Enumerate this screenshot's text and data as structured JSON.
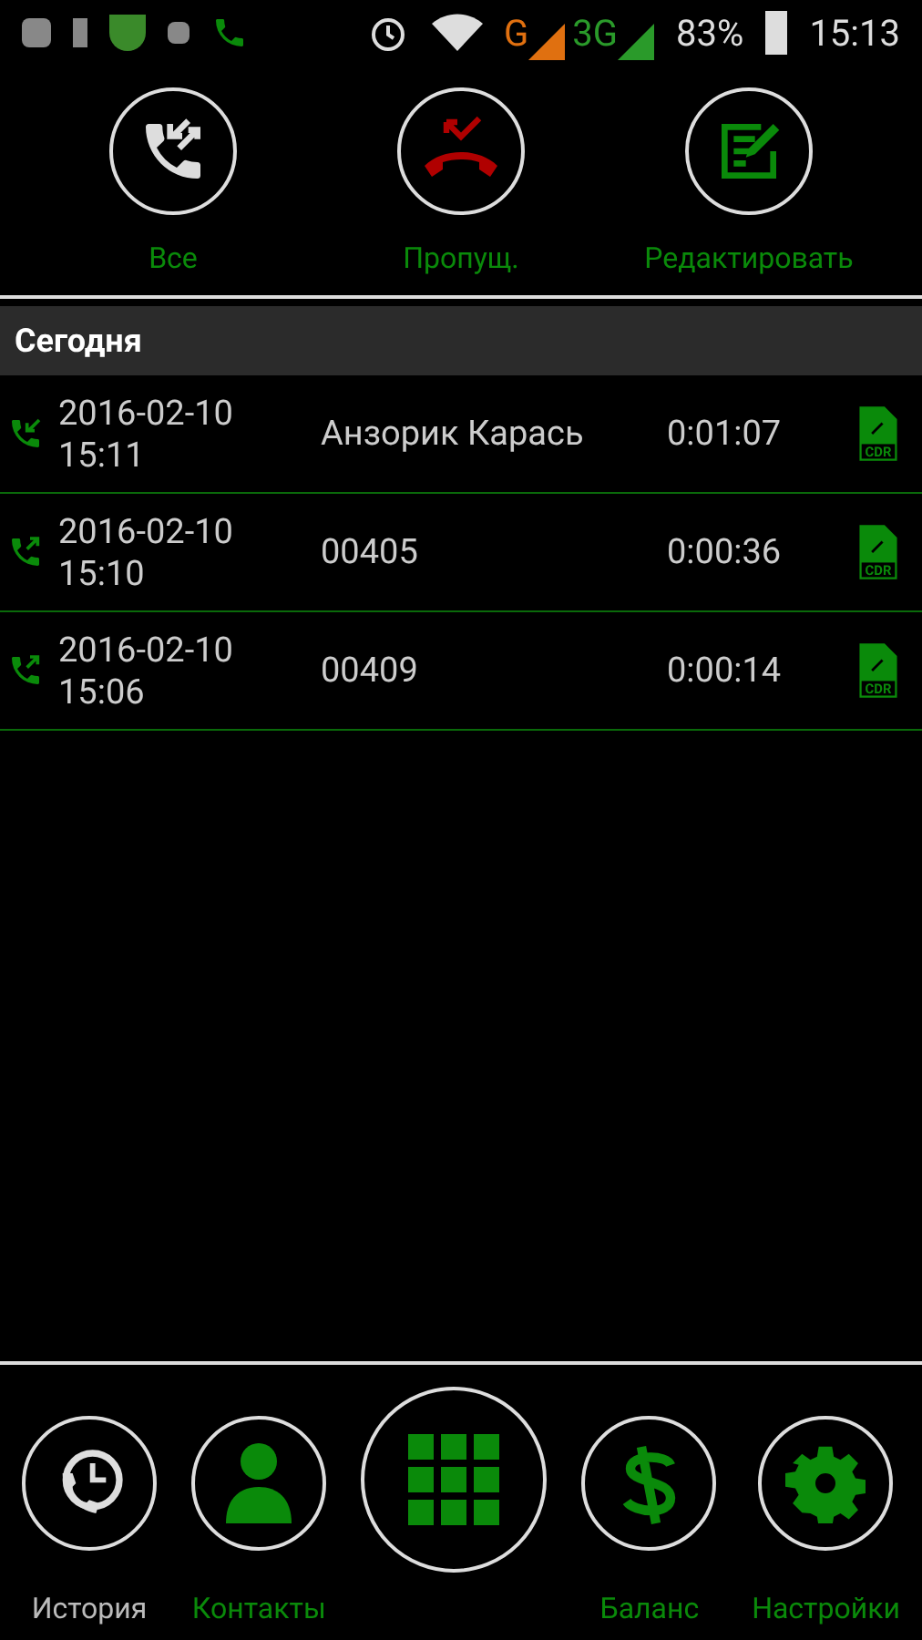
{
  "status_bar": {
    "network_2g": "G",
    "network_3g": "3G",
    "battery": "83%",
    "time": "15:13"
  },
  "filters": [
    {
      "label": "Все",
      "kind": "all"
    },
    {
      "label": "Пропущ.",
      "kind": "missed"
    },
    {
      "label": "Редактировать",
      "kind": "edit"
    }
  ],
  "section": {
    "title": "Сегодня"
  },
  "calls": [
    {
      "date": "2016-02-10",
      "time": "15:11",
      "name": "Анзорик Карась",
      "duration": "0:01:07",
      "kind": "incoming",
      "file_label": "CDR"
    },
    {
      "date": "2016-02-10",
      "time": "15:10",
      "name": "00405",
      "duration": "0:00:36",
      "kind": "outgoing",
      "file_label": "CDR"
    },
    {
      "date": "2016-02-10",
      "time": "15:06",
      "name": "00409",
      "duration": "0:00:14",
      "kind": "outgoing",
      "file_label": "CDR"
    }
  ],
  "nav": [
    {
      "label": "История",
      "kind": "history",
      "selected": true
    },
    {
      "label": "Контакты",
      "kind": "contacts",
      "selected": false
    },
    {
      "kind": "dialpad",
      "selected": false
    },
    {
      "label": "Баланс",
      "kind": "balance",
      "selected": false
    },
    {
      "label": "Настройки",
      "kind": "settings",
      "selected": false
    }
  ]
}
